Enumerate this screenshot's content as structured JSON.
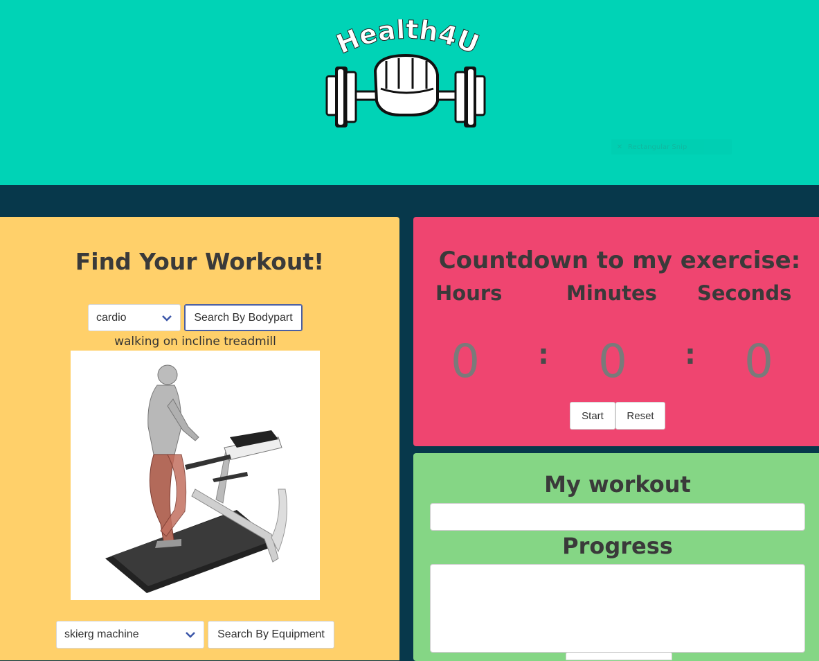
{
  "header": {
    "logo_text": "Health4U",
    "search_hint": "Rectangular Snip",
    "bg_color": "#00d3b6"
  },
  "finder": {
    "title": "Find Your Workout!",
    "bodypart_select_value": "cardio",
    "bodypart_button": "Search By Bodypart",
    "exercise_name": "walking on incline treadmill",
    "exercise_image_icon": "treadmill-runner-illustration",
    "equipment_select_value": "skierg machine",
    "equipment_button": "Search By Equipment",
    "bg_color": "#ffd06a"
  },
  "countdown": {
    "title": "Countdown to my exercise:",
    "labels": {
      "hours": "Hours",
      "minutes": "Minutes",
      "seconds": "Seconds"
    },
    "values": {
      "hours": "0",
      "minutes": "0",
      "seconds": "0"
    },
    "separator": ":",
    "start_button": "Start",
    "reset_button": "Reset",
    "bg_color": "#ef4570"
  },
  "my_workout": {
    "title": "My workout",
    "workout_value": "",
    "progress_title": "Progress",
    "progress_value": "",
    "bg_color": "#85d685"
  }
}
